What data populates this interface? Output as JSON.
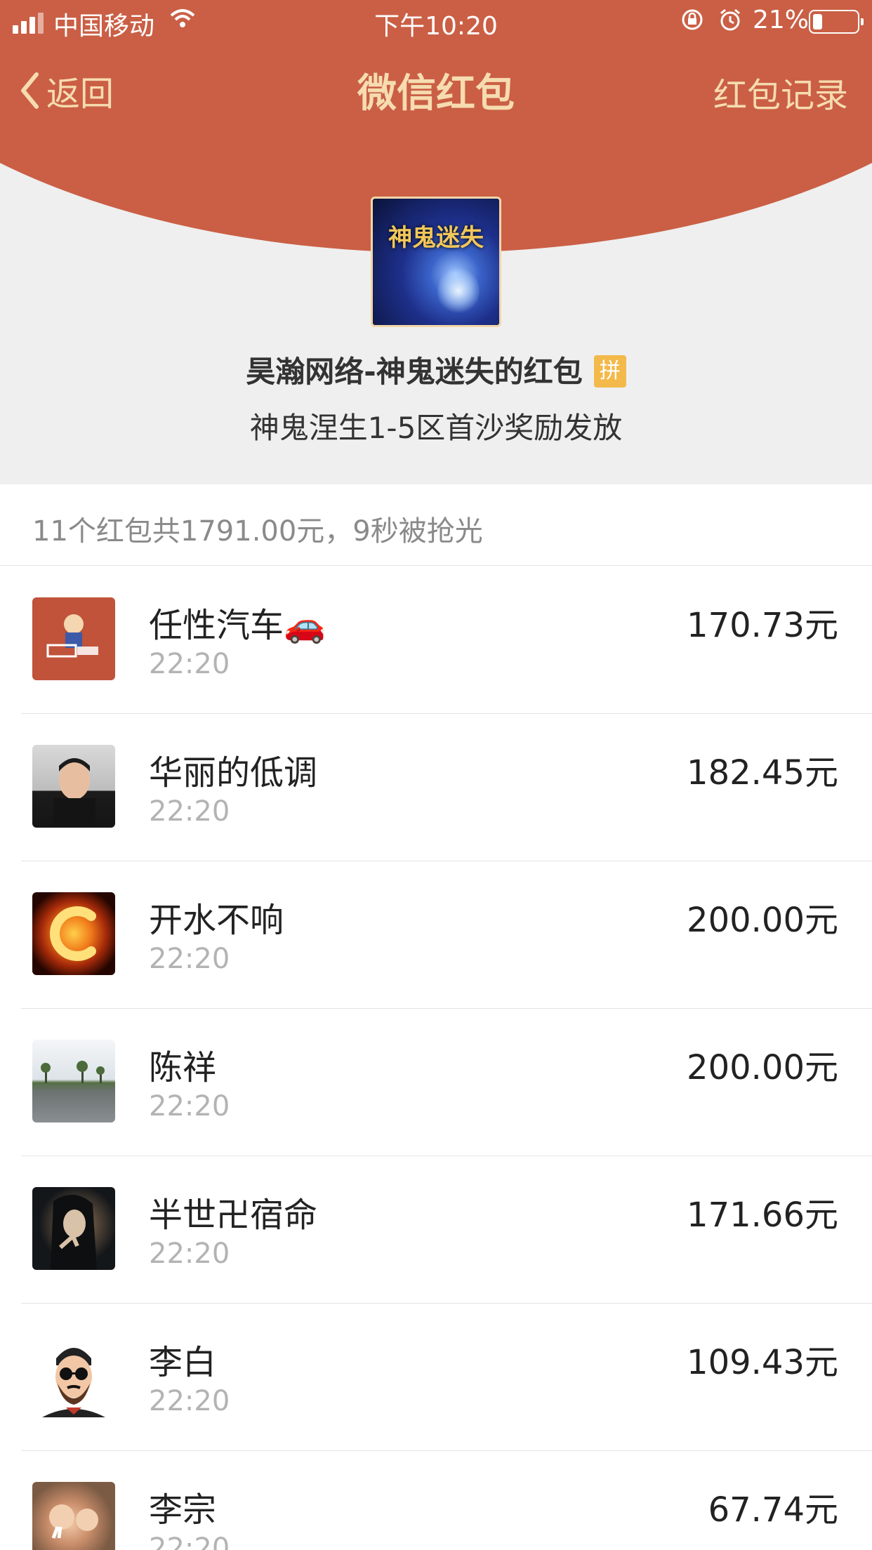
{
  "status_bar": {
    "carrier": "中国移动",
    "time": "下午10:20",
    "battery_percent": "21%",
    "battery_level": 0.21
  },
  "nav": {
    "back_label": "返回",
    "title": "微信红包",
    "record_label": "红包记录"
  },
  "packet": {
    "logo_text": "神鬼迷失",
    "sender": "昊瀚网络-神鬼迷失的红包",
    "badge": "拼",
    "blessing": "神鬼涅生1-5区首沙奖励发放"
  },
  "summary": "11个红包共1791.00元，9秒被抢光",
  "recipients": [
    {
      "name": "任性汽车🚗",
      "time": "22:20",
      "amount": "170.73元"
    },
    {
      "name": "华丽的低调",
      "time": "22:20",
      "amount": "182.45元"
    },
    {
      "name": "开水不响",
      "time": "22:20",
      "amount": "200.00元"
    },
    {
      "name": "陈祥",
      "time": "22:20",
      "amount": "200.00元"
    },
    {
      "name": "半世卍宿命",
      "time": "22:20",
      "amount": "171.66元"
    },
    {
      "name": "李白",
      "time": "22:20",
      "amount": "109.43元"
    },
    {
      "name": "李宗",
      "time": "22:20",
      "amount": "67.74元"
    }
  ],
  "colors": {
    "header_red": "#ca5f45",
    "nav_text": "#f6dcb0",
    "badge": "#f3b94a"
  }
}
